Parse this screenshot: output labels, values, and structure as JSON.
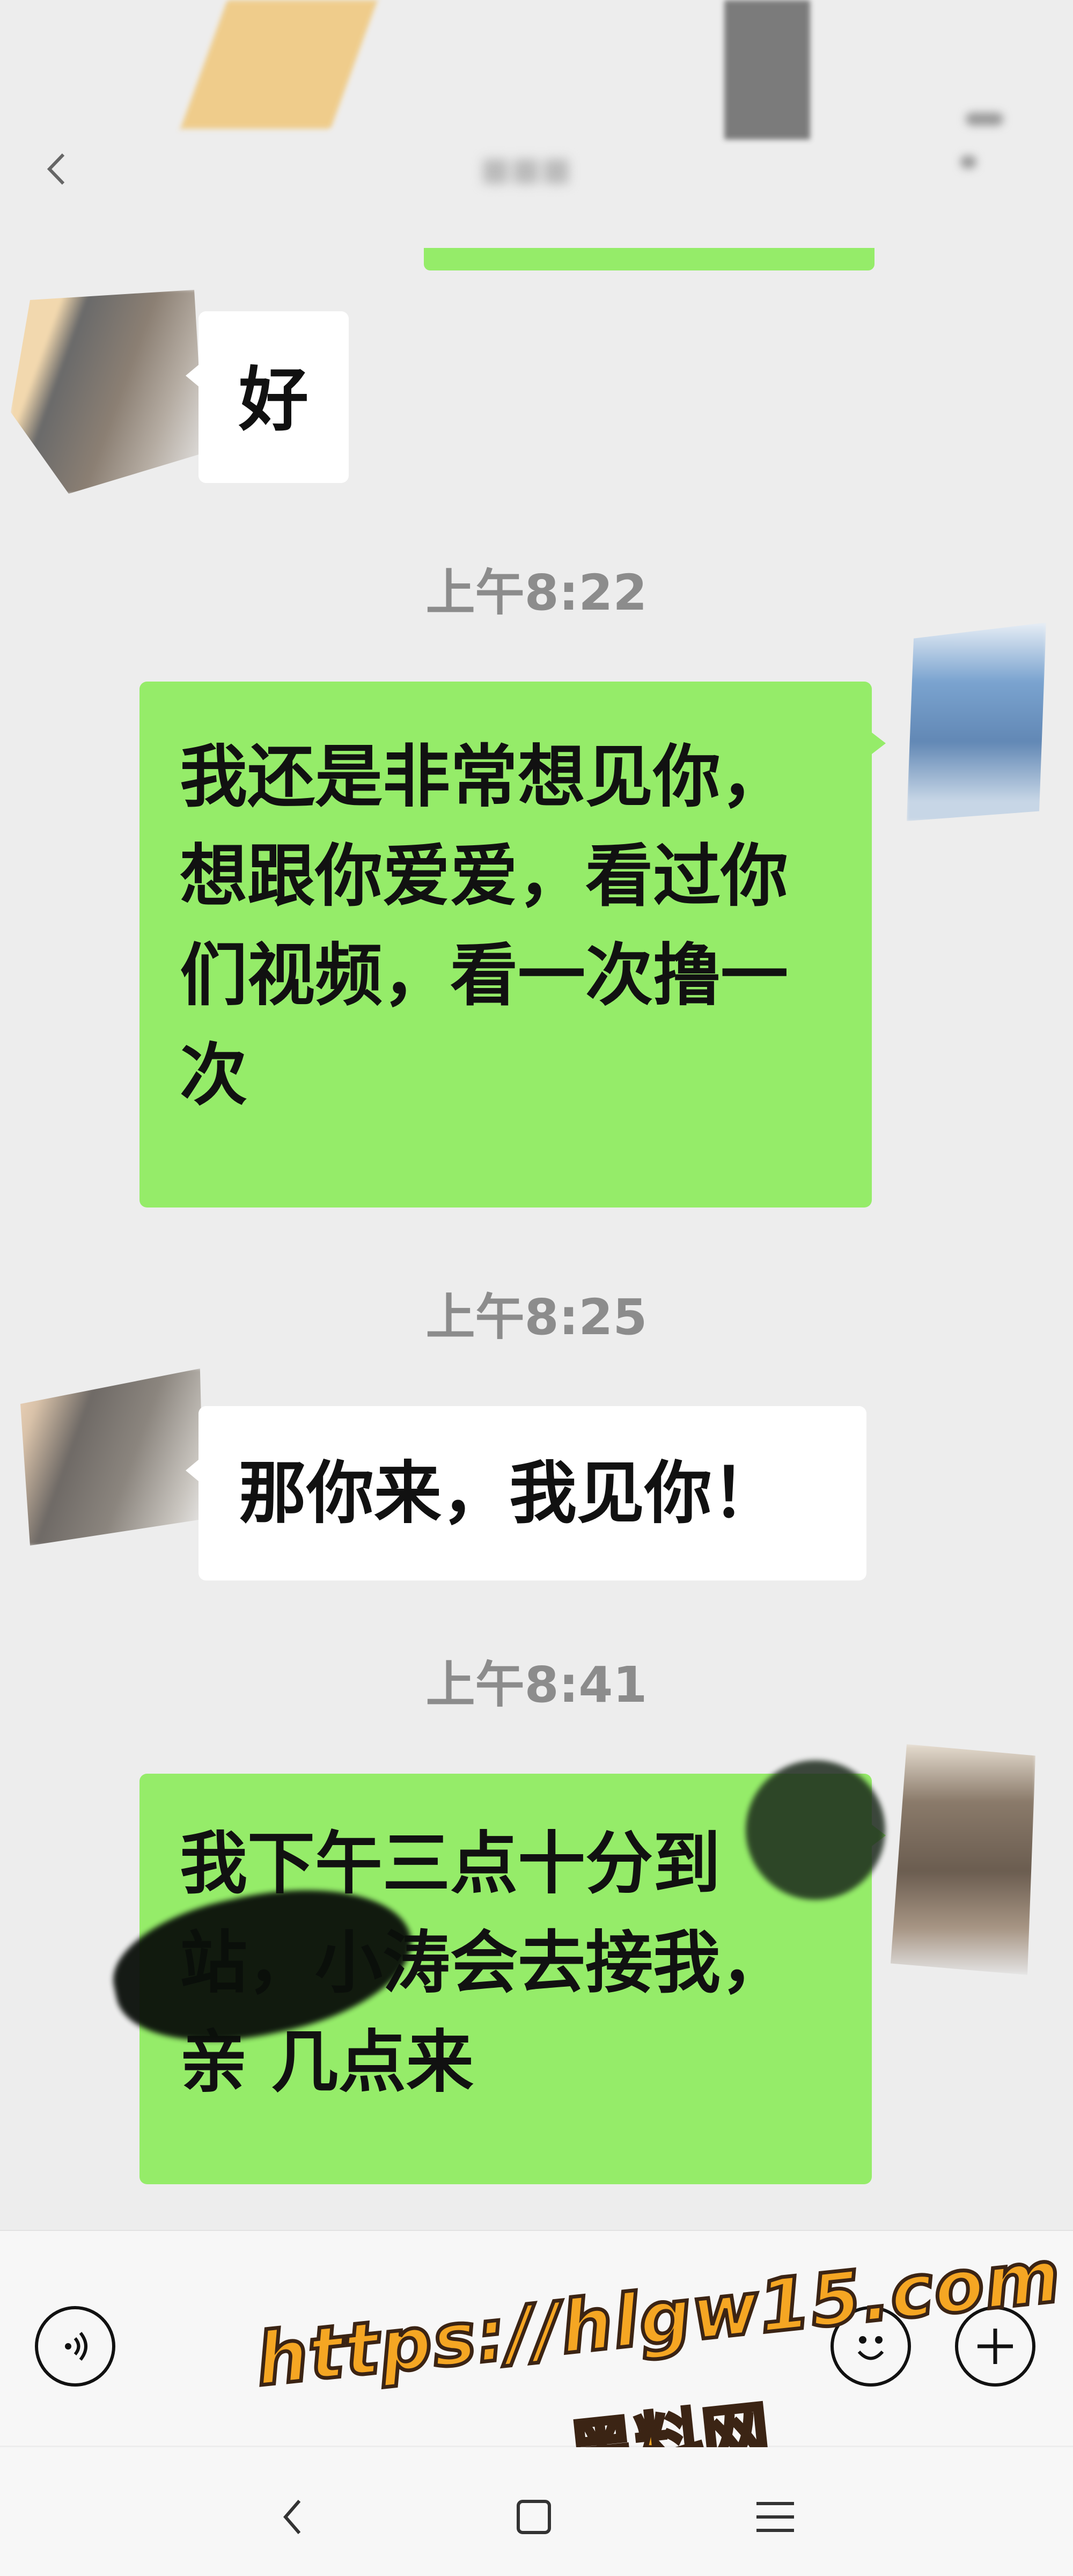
{
  "messages": [
    {
      "side": "left",
      "text": "好"
    },
    {
      "side": "right",
      "text": "我还是非常想见你，想跟你爱爱，看过你们视频，看一次撸一次"
    },
    {
      "side": "left",
      "text": "那你来，我见你！"
    },
    {
      "side": "right",
      "text": "我下午三点十分到 站，小涛会去接我，亲 几点来"
    }
  ],
  "timestamps": [
    "上午8:22",
    "上午8:25",
    "上午8:41"
  ],
  "input_bar": {
    "voice_icon": "voice-icon",
    "emoji_icon": "emoji-icon",
    "plus_icon": "plus-icon"
  },
  "watermark": {
    "url": "https://hlgw15.com",
    "name": "黑料网"
  },
  "nav": {
    "back_icon": "back-icon",
    "home_icon": "home-icon",
    "menu_icon": "menu-icon"
  },
  "colors": {
    "background": "#ededed",
    "sent_bubble": "#95ec69",
    "received_bubble": "#ffffff",
    "timestamp": "#8c8c8c",
    "watermark": "#f5a623"
  }
}
